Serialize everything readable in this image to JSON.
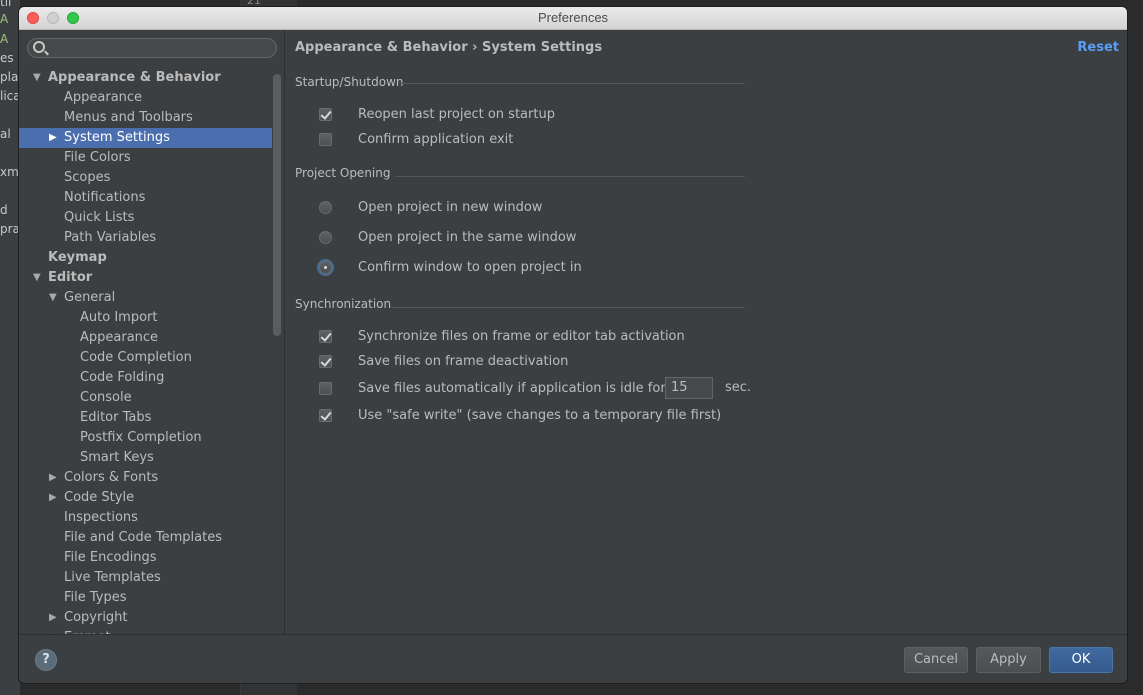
{
  "background": {
    "left_fragments": [
      "til",
      "A",
      "A",
      "es",
      "plat",
      "lica",
      "al",
      "xml",
      "d",
      "prar"
    ],
    "gutter_line": "21"
  },
  "window": {
    "title": "Preferences"
  },
  "search": {
    "placeholder": "",
    "value": ""
  },
  "tree": [
    {
      "label": "Appearance & Behavior",
      "level": 0,
      "arrow": "down",
      "bold": true,
      "badge": false
    },
    {
      "label": "Appearance",
      "level": 1,
      "arrow": "",
      "bold": false,
      "badge": false
    },
    {
      "label": "Menus and Toolbars",
      "level": 1,
      "arrow": "",
      "bold": false,
      "badge": false
    },
    {
      "label": "System Settings",
      "level": 1,
      "arrow": "right",
      "bold": false,
      "badge": false,
      "selected": true
    },
    {
      "label": "File Colors",
      "level": 1,
      "arrow": "",
      "bold": false,
      "badge": true
    },
    {
      "label": "Scopes",
      "level": 1,
      "arrow": "",
      "bold": false,
      "badge": true
    },
    {
      "label": "Notifications",
      "level": 1,
      "arrow": "",
      "bold": false,
      "badge": false
    },
    {
      "label": "Quick Lists",
      "level": 1,
      "arrow": "",
      "bold": false,
      "badge": false
    },
    {
      "label": "Path Variables",
      "level": 1,
      "arrow": "",
      "bold": false,
      "badge": false
    },
    {
      "label": "Keymap",
      "level": 0,
      "arrow": "",
      "bold": true,
      "badge": false
    },
    {
      "label": "Editor",
      "level": 0,
      "arrow": "down",
      "bold": true,
      "badge": false
    },
    {
      "label": "General",
      "level": 1,
      "arrow": "down",
      "bold": false,
      "badge": false
    },
    {
      "label": "Auto Import",
      "level": 2,
      "arrow": "",
      "bold": false,
      "badge": false
    },
    {
      "label": "Appearance",
      "level": 2,
      "arrow": "",
      "bold": false,
      "badge": false
    },
    {
      "label": "Code Completion",
      "level": 2,
      "arrow": "",
      "bold": false,
      "badge": false
    },
    {
      "label": "Code Folding",
      "level": 2,
      "arrow": "",
      "bold": false,
      "badge": false
    },
    {
      "label": "Console",
      "level": 2,
      "arrow": "",
      "bold": false,
      "badge": false
    },
    {
      "label": "Editor Tabs",
      "level": 2,
      "arrow": "",
      "bold": false,
      "badge": false
    },
    {
      "label": "Postfix Completion",
      "level": 2,
      "arrow": "",
      "bold": false,
      "badge": false
    },
    {
      "label": "Smart Keys",
      "level": 2,
      "arrow": "",
      "bold": false,
      "badge": false
    },
    {
      "label": "Colors & Fonts",
      "level": 1,
      "arrow": "right",
      "bold": false,
      "badge": false
    },
    {
      "label": "Code Style",
      "level": 1,
      "arrow": "right",
      "bold": false,
      "badge": true
    },
    {
      "label": "Inspections",
      "level": 1,
      "arrow": "",
      "bold": false,
      "badge": true
    },
    {
      "label": "File and Code Templates",
      "level": 1,
      "arrow": "",
      "bold": false,
      "badge": true
    },
    {
      "label": "File Encodings",
      "level": 1,
      "arrow": "",
      "bold": false,
      "badge": true
    },
    {
      "label": "Live Templates",
      "level": 1,
      "arrow": "",
      "bold": false,
      "badge": false
    },
    {
      "label": "File Types",
      "level": 1,
      "arrow": "",
      "bold": false,
      "badge": false
    },
    {
      "label": "Copyright",
      "level": 1,
      "arrow": "right",
      "bold": false,
      "badge": true
    },
    {
      "label": "Emmet",
      "level": 1,
      "arrow": "right",
      "bold": false,
      "badge": false
    }
  ],
  "content": {
    "breadcrumb": "Appearance & Behavior › System Settings",
    "reset_label": "Reset",
    "startup": {
      "title": "Startup/Shutdown",
      "reopen_label": "Reopen last project on startup",
      "reopen_checked": true,
      "confirm_exit_label": "Confirm application exit",
      "confirm_exit_checked": false
    },
    "project_opening": {
      "title": "Project Opening",
      "options": [
        {
          "label": "Open project in new window",
          "selected": false
        },
        {
          "label": "Open project in the same window",
          "selected": false
        },
        {
          "label": "Confirm window to open project in",
          "selected": true
        }
      ]
    },
    "sync": {
      "title": "Synchronization",
      "sync_frame_label": "Synchronize files on frame or editor tab activation",
      "sync_frame_checked": true,
      "save_deactivation_label": "Save files on frame deactivation",
      "save_deactivation_checked": true,
      "save_idle_label": "Save files automatically if application is idle for",
      "save_idle_checked": false,
      "idle_seconds": "15",
      "sec_label": "sec.",
      "safe_write_label": "Use \"safe write\" (save changes to a temporary file first)",
      "safe_write_checked": true
    }
  },
  "footer": {
    "help_label": "?",
    "cancel_label": "Cancel",
    "apply_label": "Apply",
    "ok_label": "OK"
  }
}
